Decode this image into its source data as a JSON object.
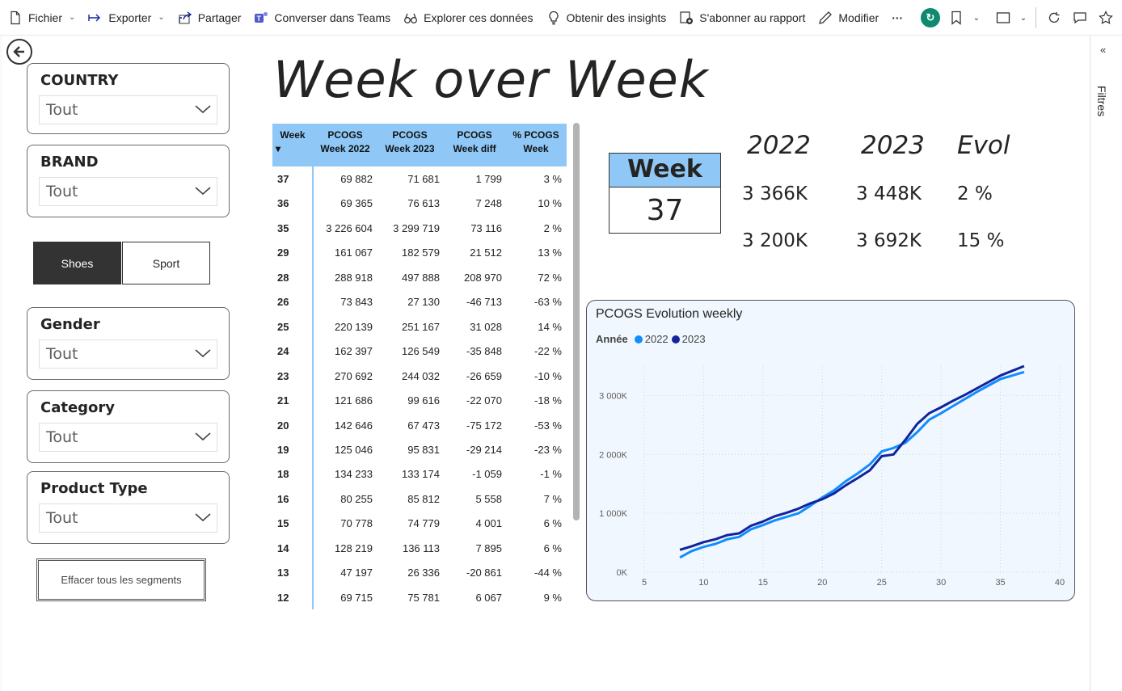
{
  "toolbar": {
    "file": "Fichier",
    "export": "Exporter",
    "share": "Partager",
    "teams": "Converser dans Teams",
    "explore": "Explorer ces données",
    "insights": "Obtenir des insights",
    "subscribe": "S'abonner au rapport",
    "edit": "Modifier",
    "more": "···"
  },
  "filters_pane": {
    "label": "Filtres"
  },
  "title": "Week over Week",
  "slicers": [
    {
      "title": "COUNTRY",
      "value": "Tout"
    },
    {
      "title": "BRAND",
      "value": "Tout"
    },
    {
      "title": "Gender",
      "value": "Tout"
    },
    {
      "title": "Category",
      "value": "Tout"
    },
    {
      "title": "Product Type",
      "value": "Tout"
    }
  ],
  "segments": {
    "shoes": "Shoes",
    "sport": "Sport"
  },
  "clear_button": "Effacer tous les segments",
  "table": {
    "headers": {
      "week": "Week",
      "week_sort": "▾",
      "c2022_1": "PCOGS",
      "c2022_2": "Week 2022",
      "c2023_1": "PCOGS",
      "c2023_2": "Week 2023",
      "diff_1": "PCOGS",
      "diff_2": "Week diff",
      "pct_1": "% PCOGS",
      "pct_2": "Week"
    },
    "rows": [
      [
        "37",
        "69 882",
        "71 681",
        "1 799",
        "3 %"
      ],
      [
        "36",
        "69 365",
        "76 613",
        "7 248",
        "10 %"
      ],
      [
        "35",
        "3 226 604",
        "3 299 719",
        "73 116",
        "2 %"
      ],
      [
        "29",
        "161 067",
        "182 579",
        "21 512",
        "13 %"
      ],
      [
        "28",
        "288 918",
        "497 888",
        "208 970",
        "72 %"
      ],
      [
        "26",
        "73 843",
        "27 130",
        "-46 713",
        "-63 %"
      ],
      [
        "25",
        "220 139",
        "251 167",
        "31 028",
        "14 %"
      ],
      [
        "24",
        "162 397",
        "126 549",
        "-35 848",
        "-22 %"
      ],
      [
        "23",
        "270 692",
        "244 032",
        "-26 659",
        "-10 %"
      ],
      [
        "21",
        "121 686",
        "99 616",
        "-22 070",
        "-18 %"
      ],
      [
        "20",
        "142 646",
        "67 473",
        "-75 172",
        "-53 %"
      ],
      [
        "19",
        "125 046",
        "95 831",
        "-29 214",
        "-23 %"
      ],
      [
        "18",
        "134 233",
        "133 174",
        "-1 059",
        "-1 %"
      ],
      [
        "16",
        "80 255",
        "85 812",
        "5 558",
        "7 %"
      ],
      [
        "15",
        "70 778",
        "74 779",
        "4 001",
        "6 %"
      ],
      [
        "14",
        "128 219",
        "136 113",
        "7 895",
        "6 %"
      ],
      [
        "13",
        "47 197",
        "26 336",
        "-20 861",
        "-44 %"
      ],
      [
        "12",
        "69 715",
        "75 781",
        "6 067",
        "9 %"
      ]
    ]
  },
  "week_card": {
    "label": "Week",
    "value": "37"
  },
  "kpis": {
    "h2022": "2022",
    "h2023": "2023",
    "hevol": "Evol",
    "r1": {
      "v2022": "3 366K",
      "v2023": "3 448K",
      "evol": "2 %"
    },
    "r2": {
      "v2022": "3 200K",
      "v2023": "3 692K",
      "evol": "15 %"
    }
  },
  "chart": {
    "title": "PCOGS Evolution weekly",
    "legend_title": "Année",
    "colors": {
      "c2022": "#118dff",
      "c2023": "#12239e"
    }
  },
  "chart_data": {
    "type": "line",
    "title": "PCOGS Evolution weekly",
    "legend_title": "Année",
    "xlim": [
      5,
      40
    ],
    "ylim": [
      0,
      3500000
    ],
    "x_ticks": [
      "5",
      "10",
      "15",
      "20",
      "25",
      "30",
      "35",
      "40"
    ],
    "y_ticks": [
      "0K",
      "1 000K",
      "2 000K",
      "3 000K"
    ],
    "series": [
      {
        "name": "2022",
        "color": "#118dff",
        "x": [
          8,
          9,
          10,
          11,
          12,
          13,
          14,
          15,
          16,
          17,
          18,
          19,
          20,
          21,
          22,
          23,
          24,
          25,
          26,
          27,
          28,
          29,
          30,
          31,
          32,
          33,
          34,
          35,
          36,
          37
        ],
        "y": [
          250000,
          360000,
          430000,
          480000,
          560000,
          600000,
          730000,
          800000,
          880000,
          940000,
          1000000,
          1130000,
          1270000,
          1390000,
          1550000,
          1680000,
          1830000,
          2050000,
          2110000,
          2200000,
          2380000,
          2590000,
          2700000,
          2820000,
          2940000,
          3060000,
          3170000,
          3280000,
          3340000,
          3400000
        ]
      },
      {
        "name": "2023",
        "color": "#12239e",
        "x": [
          8,
          9,
          10,
          11,
          12,
          13,
          14,
          15,
          16,
          17,
          18,
          19,
          20,
          21,
          22,
          23,
          24,
          25,
          26,
          27,
          28,
          29,
          30,
          31,
          32,
          33,
          34,
          35,
          36,
          37
        ],
        "y": [
          380000,
          440000,
          510000,
          560000,
          630000,
          660000,
          790000,
          860000,
          950000,
          1010000,
          1080000,
          1170000,
          1240000,
          1340000,
          1480000,
          1600000,
          1730000,
          1970000,
          2000000,
          2250000,
          2520000,
          2700000,
          2800000,
          2910000,
          3010000,
          3120000,
          3230000,
          3340000,
          3420000,
          3500000
        ]
      }
    ]
  }
}
